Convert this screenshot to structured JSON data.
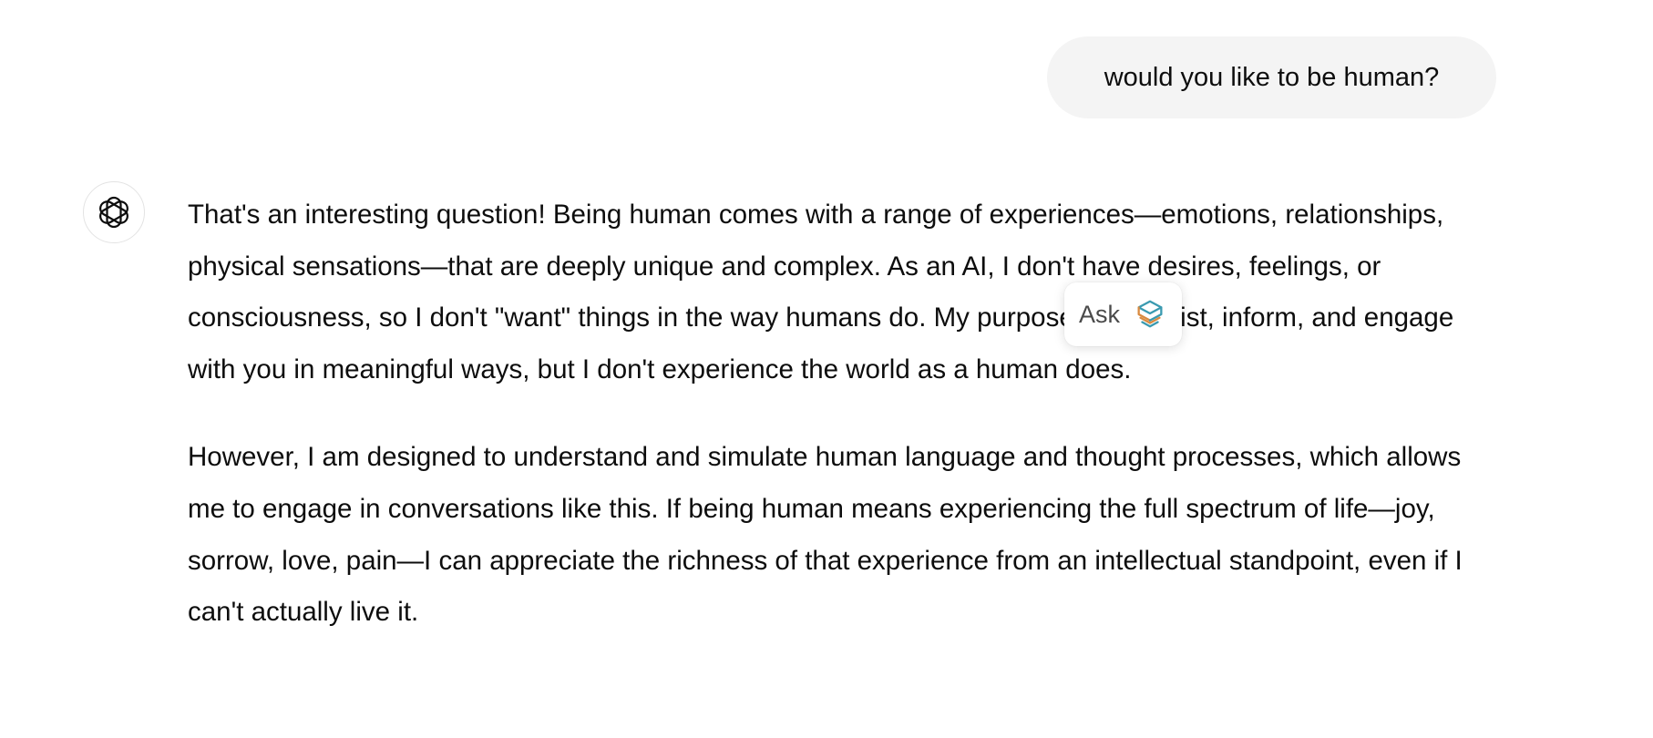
{
  "user_message": {
    "text": "would you like to be human?"
  },
  "assistant": {
    "avatar_icon": "chatgpt-logo-icon",
    "paragraphs": [
      "That's an interesting question! Being human comes with a range of experiences—emotions, relationships, physical sensations—that are deeply unique and complex. As an AI, I don't have desires, feelings, or consciousness, so I don't \"want\" things in the way humans do. My purpose is to assist, inform, and engage with you in meaningful ways, but I don't experience the world as a human does.",
      "However, I am designed to understand and simulate human language and thought processes, which allows me to engage in conversations like this. If being human means experiencing the full spectrum of life—joy, sorrow, love, pain—I can appreciate the richness of that experience from an intellectual standpoint, even if I can't actually live it."
    ]
  },
  "ask_popup": {
    "label": "Ask",
    "icon": "stacked-layers-icon",
    "colors": {
      "orange": "#d98a3f",
      "teal": "#3a9ab0"
    }
  }
}
